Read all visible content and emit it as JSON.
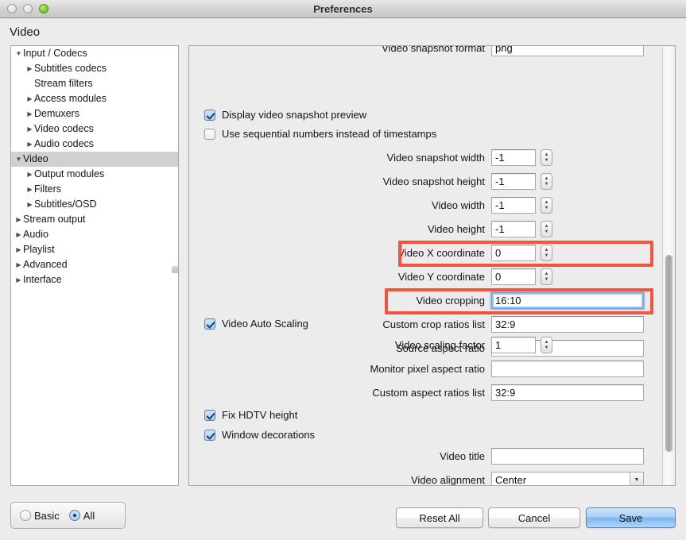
{
  "window": {
    "title": "Preferences",
    "traffic_lights": [
      "close-button",
      "minimize-button",
      "zoom-button"
    ]
  },
  "page_title": "Video",
  "sidebar": {
    "items": [
      {
        "label": "Input / Codecs",
        "depth": 0,
        "twisty": "down",
        "selected": false
      },
      {
        "label": "Subtitles codecs",
        "depth": 1,
        "twisty": "right",
        "selected": false
      },
      {
        "label": "Stream filters",
        "depth": 1,
        "twisty": "none",
        "selected": false
      },
      {
        "label": "Access modules",
        "depth": 1,
        "twisty": "right",
        "selected": false
      },
      {
        "label": "Demuxers",
        "depth": 1,
        "twisty": "right",
        "selected": false
      },
      {
        "label": "Video codecs",
        "depth": 1,
        "twisty": "right",
        "selected": false
      },
      {
        "label": "Audio codecs",
        "depth": 1,
        "twisty": "right",
        "selected": false
      },
      {
        "label": "Video",
        "depth": 0,
        "twisty": "down",
        "selected": true
      },
      {
        "label": "Output modules",
        "depth": 1,
        "twisty": "right",
        "selected": false
      },
      {
        "label": "Filters",
        "depth": 1,
        "twisty": "right",
        "selected": false
      },
      {
        "label": "Subtitles/OSD",
        "depth": 1,
        "twisty": "right",
        "selected": false
      },
      {
        "label": "Stream output",
        "depth": 0,
        "twisty": "right",
        "selected": false
      },
      {
        "label": "Audio",
        "depth": 0,
        "twisty": "right",
        "selected": false
      },
      {
        "label": "Playlist",
        "depth": 0,
        "twisty": "right",
        "selected": false
      },
      {
        "label": "Advanced",
        "depth": 0,
        "twisty": "right",
        "selected": false
      },
      {
        "label": "Interface",
        "depth": 0,
        "twisty": "right",
        "selected": false
      }
    ]
  },
  "main": {
    "clipped_row": {
      "label": "Video snapshot format",
      "value": "png"
    },
    "checkbox_snapshot_preview": {
      "label": "Display video snapshot preview",
      "checked": true
    },
    "checkbox_sequential": {
      "label": "Use sequential numbers instead of timestamps",
      "checked": false
    },
    "checkbox_auto_scaling": {
      "label": "Video Auto Scaling",
      "checked": true
    },
    "checkbox_fix_hdtv": {
      "label": "Fix HDTV height",
      "checked": true
    },
    "checkbox_window_decor": {
      "label": "Window decorations",
      "checked": true
    },
    "fields": {
      "snapshot_width": {
        "label": "Video snapshot width",
        "value": "-1"
      },
      "snapshot_height": {
        "label": "Video snapshot height",
        "value": "-1"
      },
      "video_width": {
        "label": "Video width",
        "value": "-1"
      },
      "video_height": {
        "label": "Video height",
        "value": "-1"
      },
      "video_x": {
        "label": "Video X coordinate",
        "value": "0"
      },
      "video_y": {
        "label": "Video Y coordinate",
        "value": "0"
      },
      "video_cropping": {
        "label": "Video cropping",
        "value": "16:10"
      },
      "custom_crop_ratios": {
        "label": "Custom crop ratios list",
        "value": "32:9"
      },
      "source_aspect_ratio": {
        "label": "Source aspect ratio",
        "value": ""
      },
      "scaling_factor": {
        "label": "Video scaling factor",
        "value": "1"
      },
      "monitor_pixel_ar": {
        "label": "Monitor pixel aspect ratio",
        "value": ""
      },
      "custom_aspect_ratios": {
        "label": "Custom aspect ratios list",
        "value": "32:9"
      },
      "video_title": {
        "label": "Video title",
        "value": ""
      },
      "video_alignment": {
        "label": "Video alignment",
        "value": "Center"
      }
    },
    "stepper_icons": {
      "up": "▲",
      "down": "▼"
    },
    "dropdown_icon": "▼"
  },
  "annotations": {
    "highlight_color": "#f4533c",
    "boxes": [
      {
        "target": "video-cropping-row"
      },
      {
        "target": "source-aspect-ratio-row"
      }
    ]
  },
  "footer": {
    "mode_basic": "Basic",
    "mode_all": "All",
    "selected_mode": "All",
    "reset_label": "Reset All",
    "cancel_label": "Cancel",
    "save_label": "Save"
  }
}
